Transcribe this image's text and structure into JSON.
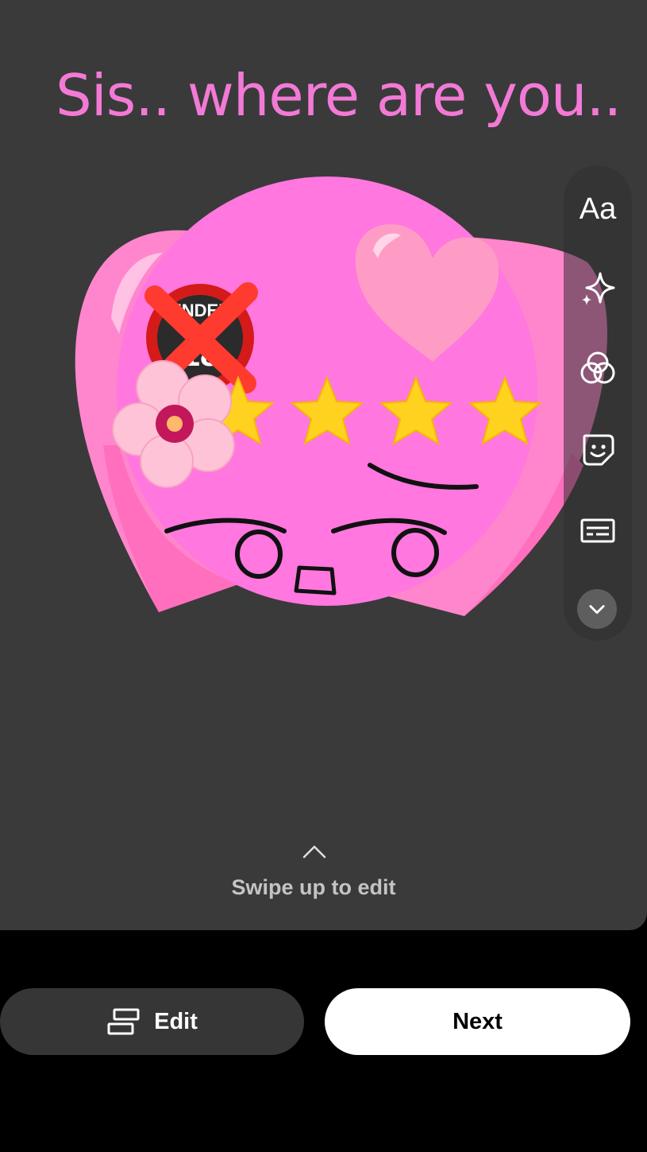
{
  "caption": "Sis.. where are you..",
  "sticker": {
    "name": "pink heart face sticker",
    "rating_stars": 4
  },
  "toolbar": {
    "text_tool_label": "Aa",
    "icons": [
      "text-icon",
      "sparkle-icon",
      "filter-icon",
      "sticker-icon",
      "captions-icon",
      "chevron-down-icon"
    ]
  },
  "swipe_hint": "Swipe up to edit",
  "buttons": {
    "edit_label": "Edit",
    "next_label": "Next"
  },
  "colors": {
    "caption": "#f27ad6",
    "canvas": "#3a3a3a",
    "sticker_pink": "#ff77df"
  }
}
